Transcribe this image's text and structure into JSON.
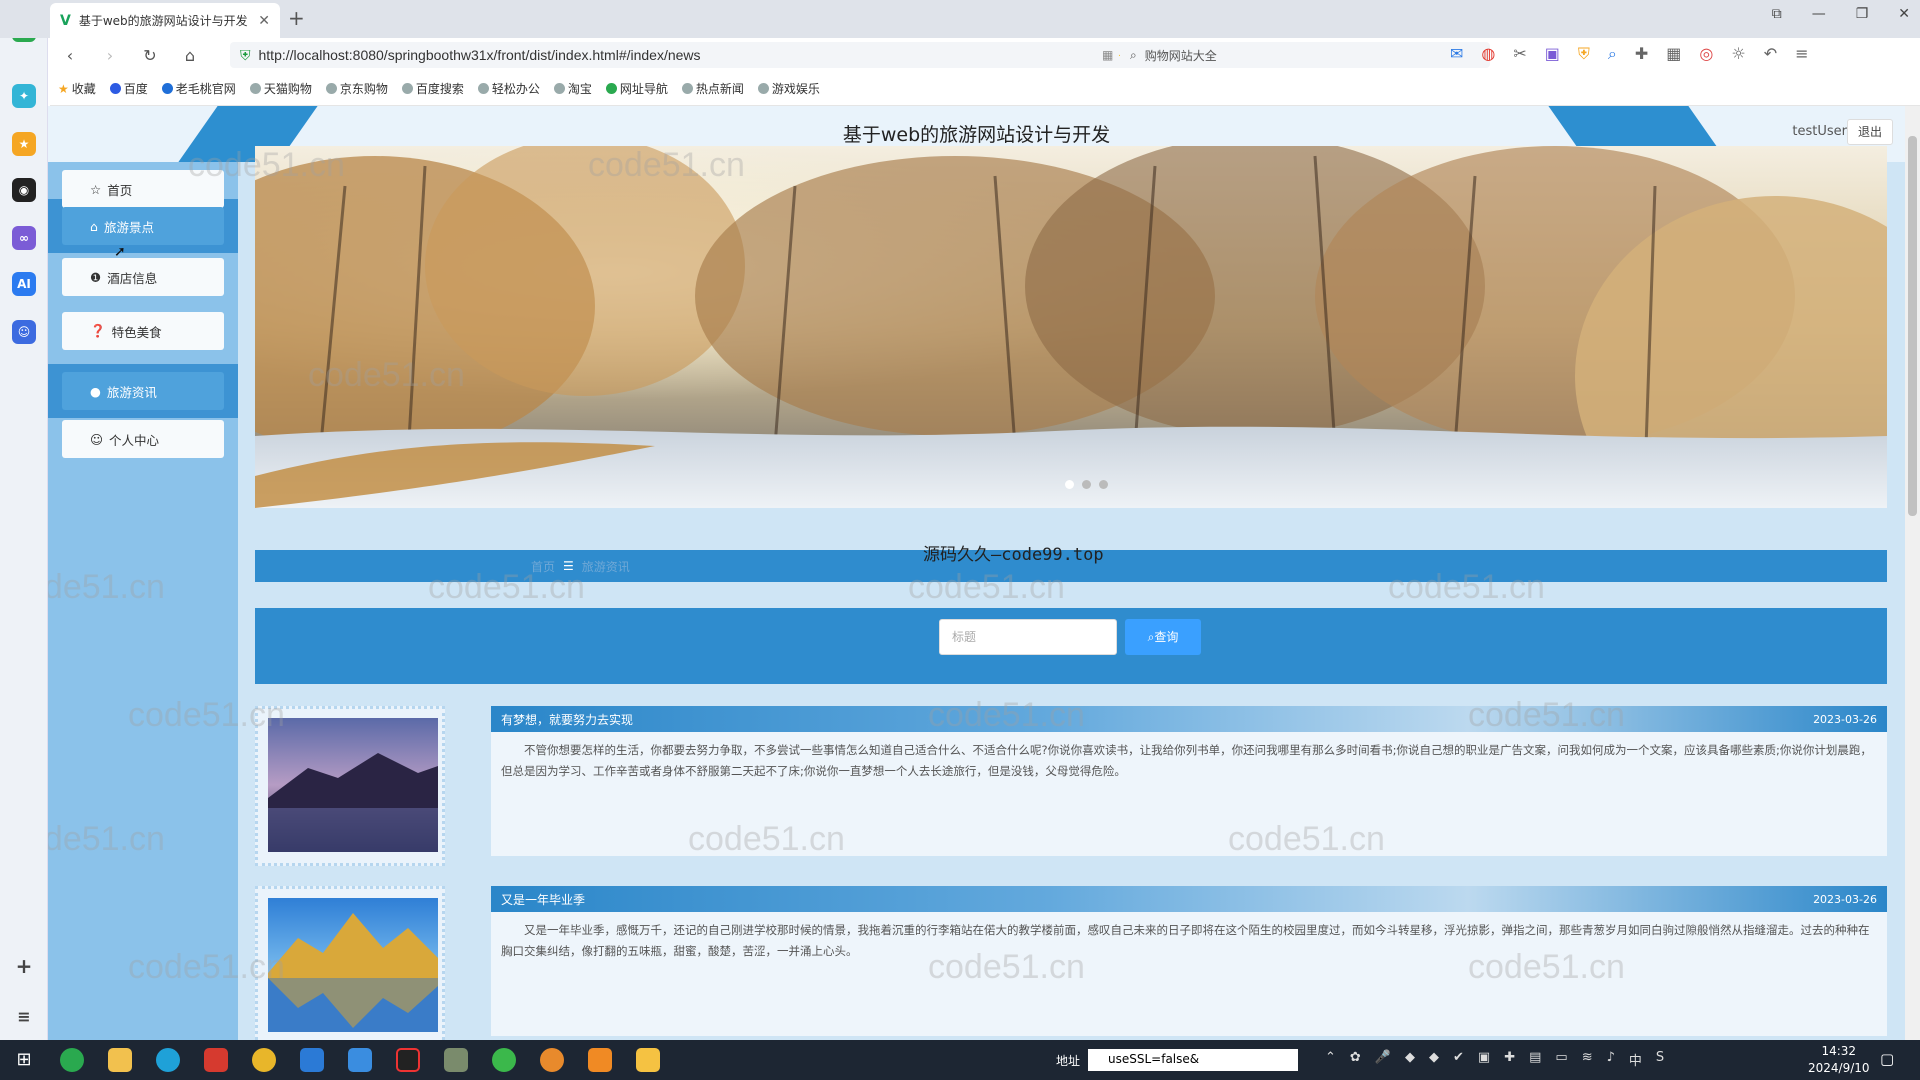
{
  "browser": {
    "tab_title": "基于web的旅游网站设计与开发",
    "url": "http://localhost:8080/springboothw31x/front/dist/index.html#/index/news",
    "search_placeholder": "购物网站大全",
    "bookmarks": [
      "收藏",
      "百度",
      "老毛桃官网",
      "天猫购物",
      "京东购物",
      "百度搜索",
      "轻松办公",
      "淘宝",
      "网址导航",
      "热点新闻",
      "游戏娱乐"
    ]
  },
  "header": {
    "title": "基于web的旅游网站设计与开发",
    "username": "testUser",
    "logout_label": "退出"
  },
  "menu": [
    {
      "label": "首页",
      "icon": "star-icon"
    },
    {
      "label": "旅游景点",
      "icon": "home-icon"
    },
    {
      "label": "酒店信息",
      "icon": "info-icon"
    },
    {
      "label": "特色美食",
      "icon": "question-icon"
    },
    {
      "label": "旅游资讯",
      "icon": "info-icon"
    },
    {
      "label": "个人中心",
      "icon": "user-icon"
    }
  ],
  "banner": {
    "slide_count": 3,
    "active_slide": 1
  },
  "breadcrumb": {
    "home": "首页",
    "current": "旅游资讯"
  },
  "overlay_watermark": "源码久久—code99.top",
  "search": {
    "placeholder": "标题",
    "button_label": "查询"
  },
  "news": [
    {
      "title": "有梦想，就要努力去实现",
      "date": "2023-03-26",
      "summary": "不管你想要怎样的生活，你都要去努力争取，不多尝试一些事情怎么知道自己适合什么、不适合什么呢?你说你喜欢读书，让我给你列书单，你还问我哪里有那么多时间看书;你说自己想的职业是广告文案，问我如何成为一个文案，应该具备哪些素质;你说你计划晨跑，但总是因为学习、工作辛苦或者身体不舒服第二天起不了床;你说你一直梦想一个人去长途旅行，但是没钱，父母觉得危险。"
    },
    {
      "title": "又是一年毕业季",
      "date": "2023-03-26",
      "summary": "又是一年毕业季，感慨万千，还记的自己刚进学校那时候的情景，我拖着沉重的行李箱站在偌大的教学楼前面，感叹自己未来的日子即将在这个陌生的校园里度过，而如今斗转星移，浮光掠影，弹指之间，那些青葱岁月如同白驹过隙般悄然从指缝溜走。过去的种种在胸口交集纠结，像打翻的五味瓶，甜蜜，酸楚，苦涩，一并涌上心头。"
    }
  ],
  "watermark_text": "code51.cn",
  "taskbar": {
    "address_label": "地址",
    "address_value": "useSSL=false&",
    "time": "14:32",
    "date": "2024/9/10"
  }
}
